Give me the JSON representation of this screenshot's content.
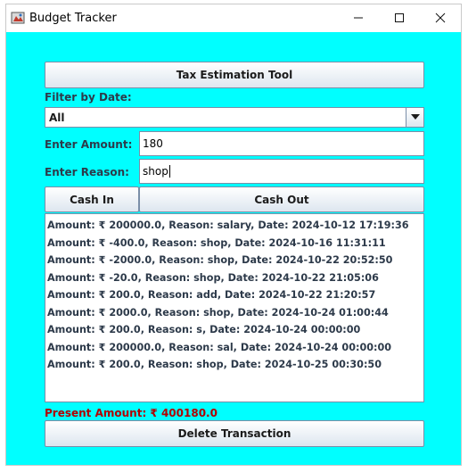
{
  "window": {
    "title": "Budget Tracker",
    "background": "#00ffff",
    "controls": [
      "minimize-icon",
      "maximize-icon",
      "close-icon"
    ]
  },
  "tax_button_label": "Tax Estimation Tool",
  "filter": {
    "label": "Filter by Date:",
    "selected": "All"
  },
  "amount": {
    "label": "Enter Amount:",
    "value": "180"
  },
  "reason": {
    "label": "Enter Reason:",
    "value": "shop"
  },
  "buttons": {
    "cash_in": "Cash In",
    "cash_out": "Cash Out",
    "delete": "Delete Transaction"
  },
  "transactions": [
    "Amount: ₹ 200000.0, Reason: salary, Date: 2024-10-12 17:19:36",
    "Amount: ₹ -400.0, Reason: shop, Date: 2024-10-16 11:31:11",
    "Amount: ₹ -2000.0, Reason: shop, Date: 2024-10-22 20:52:50",
    "Amount: ₹ -20.0, Reason: shop, Date: 2024-10-22 21:05:06",
    "Amount: ₹ 200.0, Reason: add, Date: 2024-10-22 21:20:57",
    "Amount: ₹ 2000.0, Reason: shop, Date: 2024-10-24 01:00:44",
    "Amount: ₹ 200.0, Reason: s, Date: 2024-10-24 00:00:00",
    "Amount: ₹ 200000.0, Reason: sal, Date: 2024-10-24 00:00:00",
    "Amount: ₹ 200.0, Reason: shop, Date: 2024-10-25 00:30:50"
  ],
  "present_amount": "Present Amount: ₹ 400180.0"
}
